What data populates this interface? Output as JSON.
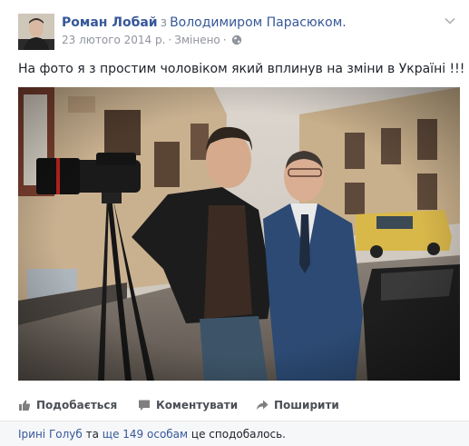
{
  "post": {
    "author": "Роман Лобай",
    "with_word": "з",
    "tagged": "Володимиром Парасюком.",
    "date": "23 лютого 2014 р.",
    "separator": "·",
    "edited": "Змінено",
    "text": "На фото я з простим чоловіком який вплинув на зміни в Україні !!!"
  },
  "actions": {
    "like": "Подобається",
    "comment": "Коментувати",
    "share": "Поширити"
  },
  "likes": {
    "first_name": "Ірині Голуб",
    "and_word": "та",
    "others": "ще 149 особам",
    "suffix": "це сподобалось."
  },
  "colors": {
    "link": "#365899",
    "meta": "#90949c",
    "text": "#1d2129",
    "action": "#4b4f56",
    "likes_bg": "#f6f7f9"
  },
  "icons": [
    "chevron-down-icon",
    "globe-icon",
    "thumbs-up-icon",
    "comment-icon",
    "share-icon"
  ]
}
